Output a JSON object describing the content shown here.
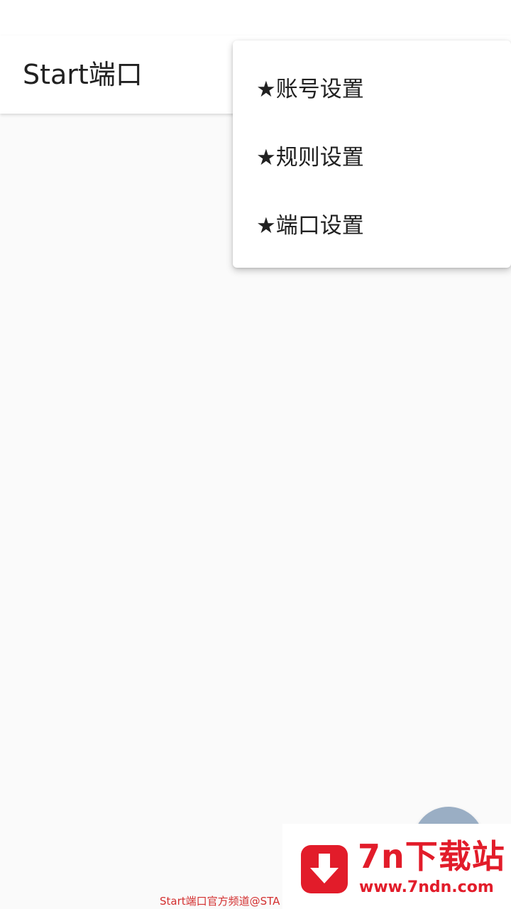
{
  "app_bar": {
    "title": "Start端口"
  },
  "menu": {
    "items": [
      {
        "label": "★账号设置"
      },
      {
        "label": "★规则设置"
      },
      {
        "label": "★端口设置"
      }
    ]
  },
  "watermark": {
    "brand": "7n下载站",
    "url": "www.7ndn.com",
    "icon": "download-arrow-icon",
    "color": "#e21c2a"
  },
  "caption": {
    "text": "Start端口官方频道@STA"
  },
  "colors": {
    "background": "#fafafa",
    "app_bar": "#ffffff",
    "fab": "#9aaec4",
    "text": "#212121",
    "caption": "#d32f2f"
  }
}
